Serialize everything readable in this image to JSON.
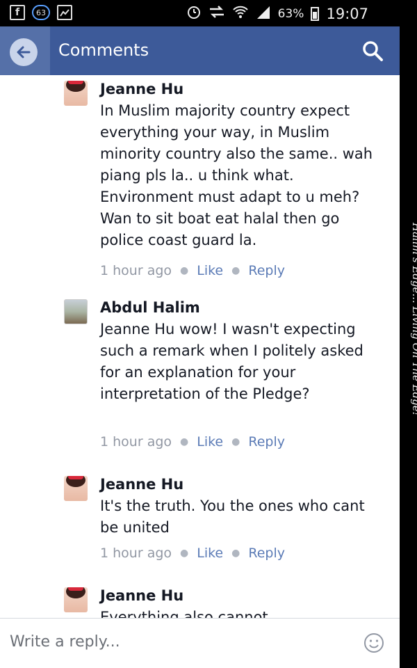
{
  "status_bar": {
    "notification_count": "63",
    "battery_percent": "63%",
    "time": "19:07"
  },
  "app_bar": {
    "title": "Comments"
  },
  "comments": [
    {
      "author": "Jeanne Hu",
      "text": "In Muslim majority country expect everything your way, in Muslim minority country also the same.. wah piang pls la.. u think what. Environment must adapt to u meh? Wan to sit boat eat halal then go police coast guard la.",
      "time": "1 hour ago",
      "like": "Like",
      "reply": "Reply"
    },
    {
      "author": "Abdul Halim",
      "text": "Jeanne Hu wow! I wasn't expecting such a remark when I politely asked for an explanation for your interpretation of the Pledge?",
      "time": "1 hour ago",
      "like": "Like",
      "reply": "Reply"
    },
    {
      "author": "Jeanne Hu",
      "text": "It's the truth. You the ones who cant be united",
      "time": "1 hour ago",
      "like": "Like",
      "reply": "Reply"
    },
    {
      "author": "Jeanne Hu",
      "text": "Everything also cannot"
    }
  ],
  "watermark": "Halim's Edge... Living On The Edge!",
  "reply_bar": {
    "placeholder": "Write a reply..."
  },
  "colors": {
    "app_bar": "#3d5a99",
    "link": "#5b7bb6",
    "meta": "#9197a3"
  }
}
